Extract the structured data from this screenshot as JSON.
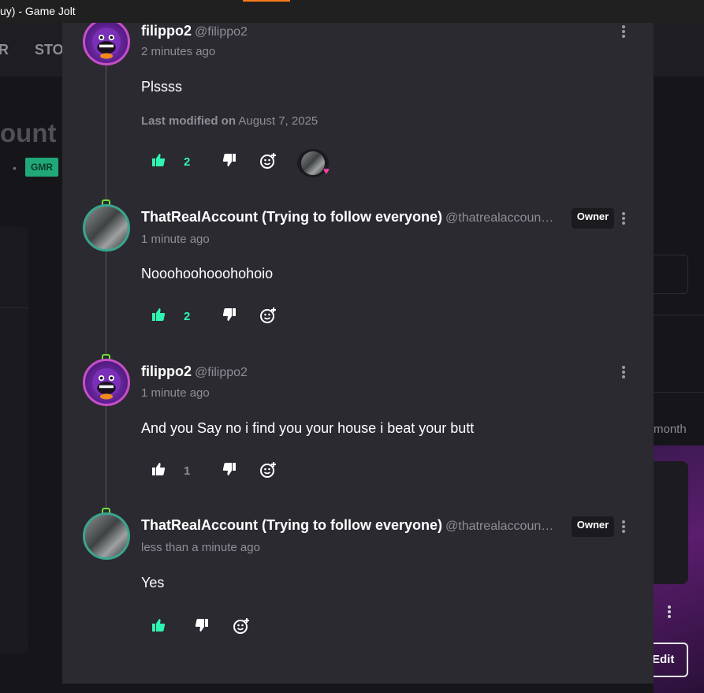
{
  "window": {
    "title": "uy) - Game Jolt"
  },
  "background": {
    "nav_items": [
      "R",
      "STO"
    ],
    "heading_fragment": "ount (",
    "badge": "GMR",
    "meta_fragment": "month",
    "edit_label": "Edit"
  },
  "colors": {
    "modal_bg": "#2b2a31",
    "like_active": "#2ff5b0",
    "owner_badge_bg": "#1b1a1f",
    "reaction_heart": "#ff3fa4"
  },
  "comments": [
    {
      "display_name": "filippo2",
      "username": "@filippo2",
      "time": "2 minutes ago",
      "text": "Plssss",
      "modified_label": "Last modified on",
      "modified_date": "August 7, 2025",
      "likes": "2",
      "liked": true,
      "avatar_icon": "purple-monster-avatar",
      "has_reaction": true
    },
    {
      "display_name": "ThatRealAccount (Trying to follow everyone)",
      "username": "@thatrealaccoun…",
      "badge": "Owner",
      "time": "1 minute ago",
      "text": "Nooohoohooohohoio",
      "likes": "2",
      "liked": true,
      "avatar_icon": "gray-photo-avatar"
    },
    {
      "display_name": "filippo2",
      "username": "@filippo2",
      "time": "1 minute ago",
      "text": "And you Say no i find you your house i beat your butt",
      "likes": "1",
      "liked": false,
      "avatar_icon": "purple-monster-avatar"
    },
    {
      "display_name": "ThatRealAccount (Trying to follow everyone)",
      "username": "@thatrealaccoun…",
      "badge": "Owner",
      "time": "less than a minute ago",
      "text": "Yes",
      "likes": "",
      "liked": true,
      "avatar_icon": "gray-photo-avatar"
    }
  ]
}
